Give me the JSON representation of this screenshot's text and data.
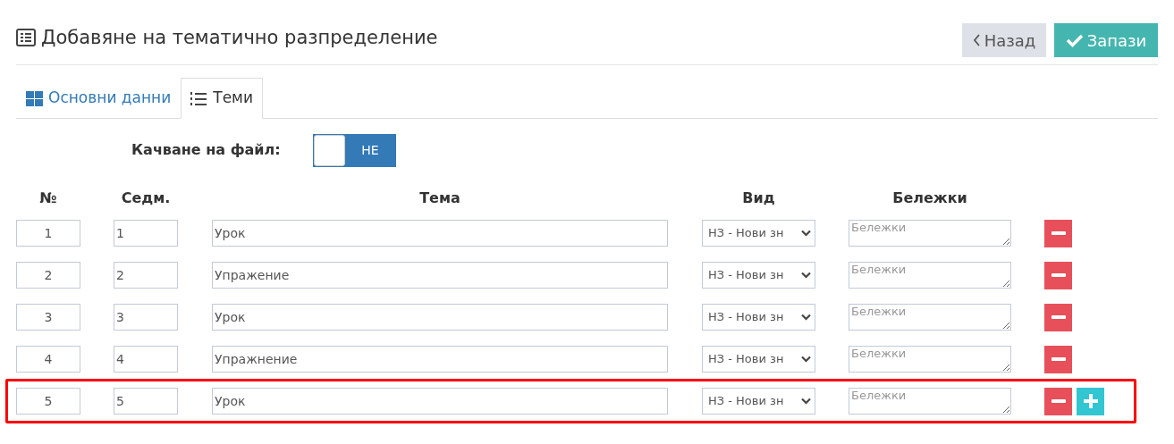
{
  "page_title": "Добавяне на тематично разпределение",
  "buttons": [
    {
      "kind": "back",
      "label": "Назад"
    },
    {
      "kind": "save",
      "label": "Запази"
    }
  ],
  "tabs": [
    {
      "kind": "grid",
      "label": "Основни данни",
      "selected": false
    },
    {
      "kind": "list",
      "label": "Теми",
      "selected": true
    }
  ],
  "upload": {
    "label": "Качване на файл:",
    "toggle_text": "НЕ",
    "on": false
  },
  "columns": [
    "№",
    "Седм.",
    "Тема",
    "Вид",
    "Бележки"
  ],
  "rows": [
    {
      "number": "1",
      "week": "1",
      "topic": "Урок",
      "type": "НЗ - Нови зн",
      "notes_placeholder": "Бележки",
      "can_add": false,
      "highlighted": false
    },
    {
      "number": "2",
      "week": "2",
      "topic": "Упражение",
      "type": "НЗ - Нови зн",
      "notes_placeholder": "Бележки",
      "can_add": false,
      "highlighted": false
    },
    {
      "number": "3",
      "week": "3",
      "topic": "Урок",
      "type": "НЗ - Нови зн",
      "notes_placeholder": "Бележки",
      "can_add": false,
      "highlighted": false
    },
    {
      "number": "4",
      "week": "4",
      "topic": "Упражнение",
      "type": "НЗ - Нови зн",
      "notes_placeholder": "Бележки",
      "can_add": false,
      "highlighted": false
    },
    {
      "number": "5",
      "week": "5",
      "topic": "Урок",
      "type": "НЗ - Нови зн",
      "notes_placeholder": "Бележки",
      "can_add": true,
      "highlighted": true
    }
  ]
}
